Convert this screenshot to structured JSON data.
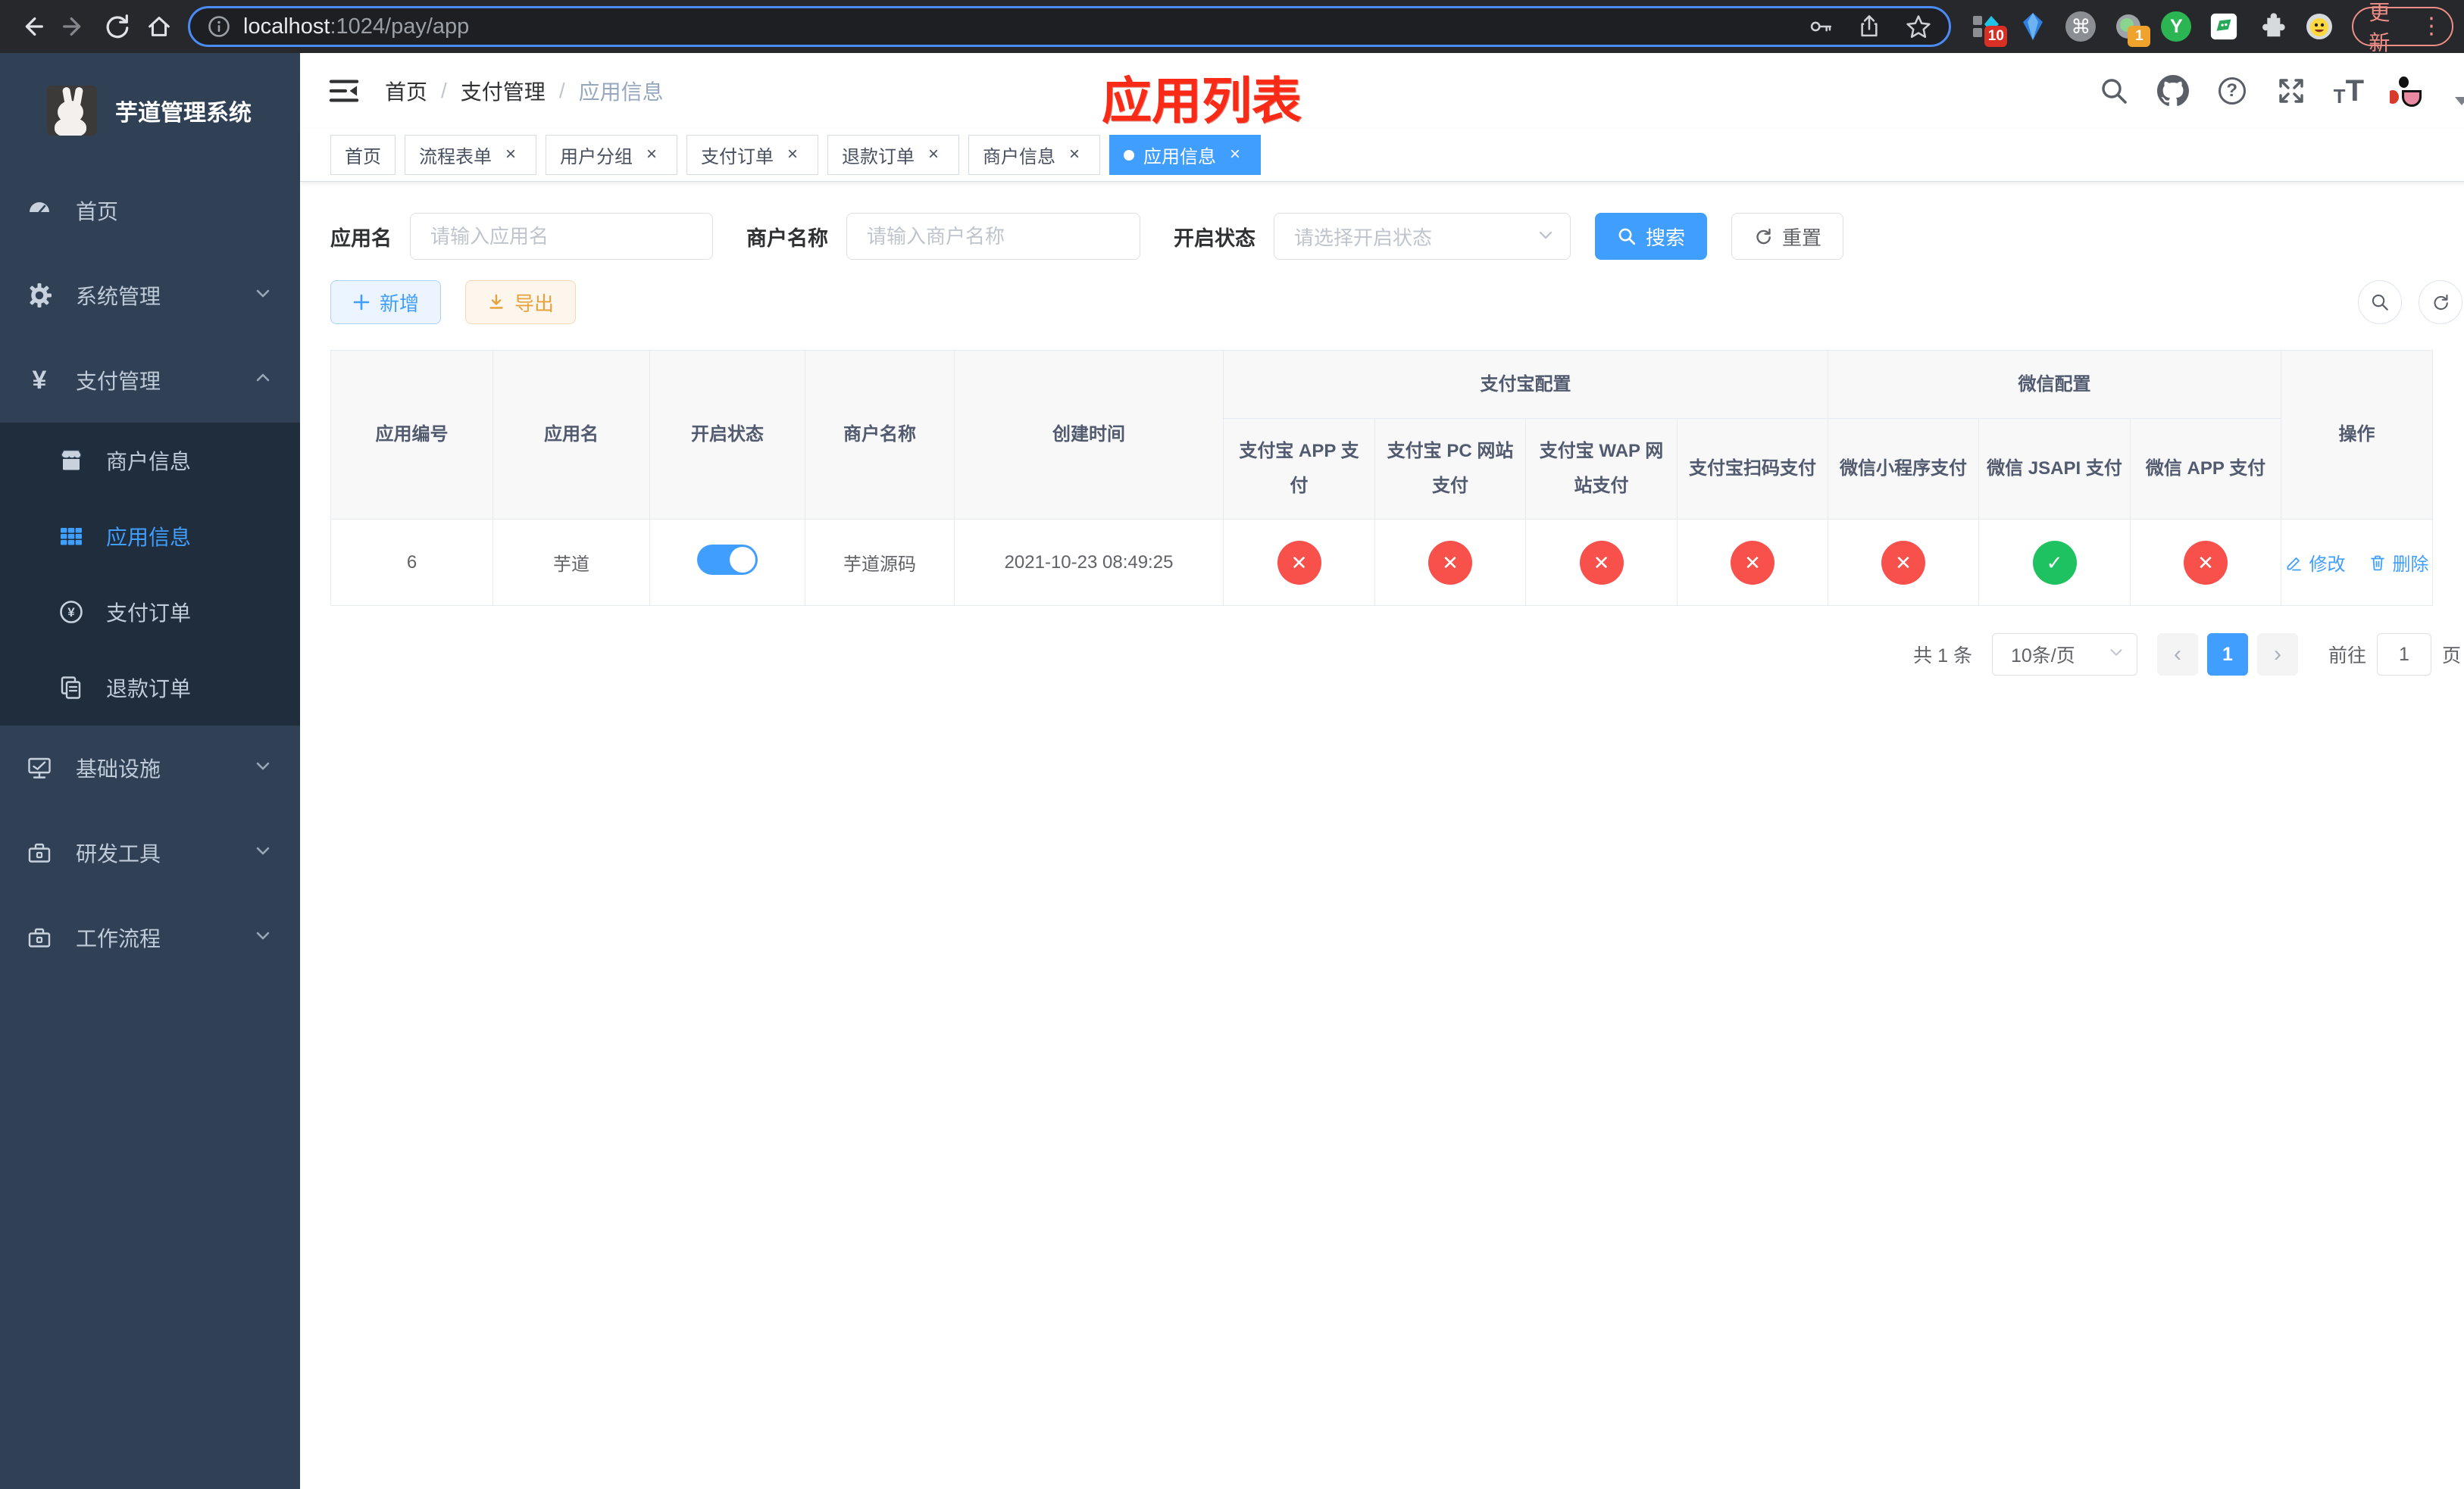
{
  "colors": {
    "accent": "#409eff",
    "success": "#1fc261",
    "danger": "#f8514c",
    "warning": "#e6a23c",
    "sidebar_bg": "#304156",
    "submenu_bg": "#1f2d3d",
    "annotation_red": "#fa2a17"
  },
  "icons": {
    "check": "✓",
    "cross": "✕",
    "command": "⌘",
    "dots_vertical": "⋮",
    "prev_arrow": "‹",
    "next_arrow": "›",
    "ext_y_letter": "Y",
    "help_mark": "?",
    "font_small": "T",
    "font_big": "T"
  },
  "browser": {
    "url_host": "localhost",
    "url_rest": ":1024/pay/app",
    "update_label": "更新",
    "ext_badge_1": "10",
    "ext_badge_2": "1"
  },
  "sidebar": {
    "title": "芋道管理系统",
    "items": [
      {
        "label": "首页"
      },
      {
        "label": "系统管理"
      },
      {
        "label": "支付管理"
      },
      {
        "label": "商户信息"
      },
      {
        "label": "应用信息"
      },
      {
        "label": "支付订单"
      },
      {
        "label": "退款订单"
      },
      {
        "label": "基础设施"
      },
      {
        "label": "研发工具"
      },
      {
        "label": "工作流程"
      }
    ]
  },
  "header": {
    "breadcrumb": [
      "首页",
      "支付管理",
      "应用信息"
    ],
    "separator": "/",
    "annotation": "应用列表"
  },
  "tabs": [
    {
      "label": "首页"
    },
    {
      "label": "流程表单"
    },
    {
      "label": "用户分组"
    },
    {
      "label": "支付订单"
    },
    {
      "label": "退款订单"
    },
    {
      "label": "商户信息"
    },
    {
      "label": "应用信息"
    }
  ],
  "tab_close": "×",
  "filters": {
    "app_name_label": "应用名",
    "app_name_placeholder": "请输入应用名",
    "merchant_label": "商户名称",
    "merchant_placeholder": "请输入商户名称",
    "status_label": "开启状态",
    "status_placeholder": "请选择开启状态",
    "search_label": "搜索",
    "reset_label": "重置"
  },
  "toolbar": {
    "add_label": "新增",
    "export_label": "导出"
  },
  "table": {
    "columns_left": [
      "应用编号",
      "应用名",
      "开启状态",
      "商户名称",
      "创建时间"
    ],
    "group_alipay": "支付宝配置",
    "group_wechat": "微信配置",
    "alipay_children": [
      "支付宝 APP 支付",
      "支付宝 PC 网站支付",
      "支付宝 WAP 网站支付",
      "支付宝扫码支付"
    ],
    "wechat_children": [
      "微信小程序支付",
      "微信 JSAPI 支付",
      "微信 APP 支付"
    ],
    "col_actions": "操作",
    "row": {
      "id": "6",
      "name": "芋道",
      "enabled": true,
      "merchant": "芋道源码",
      "created": "2021-10-23 08:49:25",
      "channels": [
        "off",
        "off",
        "off",
        "off",
        "off",
        "on",
        "off"
      ],
      "edit_label": "修改",
      "delete_label": "删除"
    }
  },
  "pagination": {
    "total_text": "共 1 条",
    "page_size": "10条/页",
    "current_page": "1",
    "goto_label": "前往",
    "goto_value": "1",
    "page_unit": "页"
  }
}
